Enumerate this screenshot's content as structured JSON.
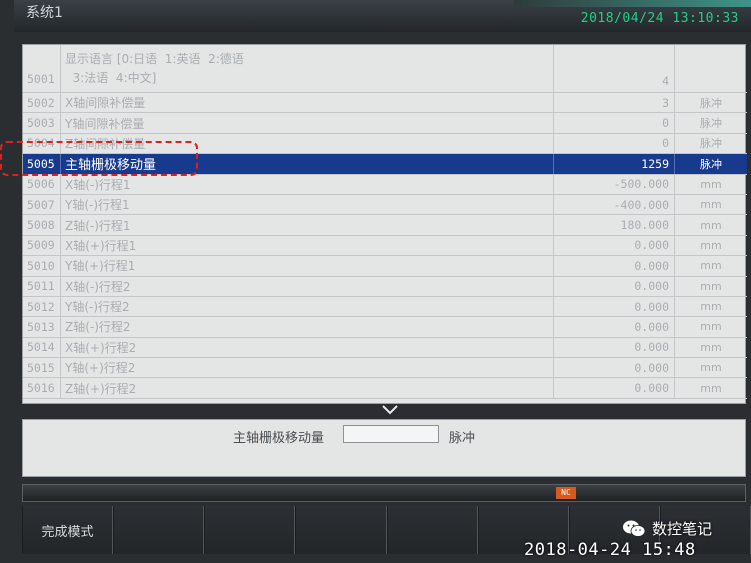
{
  "window": {
    "title": "系统1",
    "datetime": "2018/04/24 13:10:33",
    "accent_color": "#3f9a8e"
  },
  "params": [
    {
      "num": "5001",
      "name_lines": [
        "显示语言 [0:日语  1:英语  2:德语",
        "  3:法语  4:中文]"
      ],
      "value": "4",
      "unit": ""
    },
    {
      "num": "5002",
      "name": "X轴间隙补偿量",
      "value": "3",
      "unit": "脉冲"
    },
    {
      "num": "5003",
      "name": "Y轴间隙补偿量",
      "value": "0",
      "unit": "脉冲"
    },
    {
      "num": "5004",
      "name": "Z轴间隙补偿量",
      "value": "0",
      "unit": "脉冲"
    },
    {
      "num": "5005",
      "name": "主轴栅极移动量",
      "value": "1259",
      "unit": "脉冲",
      "selected": true
    },
    {
      "num": "5006",
      "name": "X轴(-)行程1",
      "value": "-500.000",
      "unit": "mm"
    },
    {
      "num": "5007",
      "name": "Y轴(-)行程1",
      "value": "-400.000",
      "unit": "mm"
    },
    {
      "num": "5008",
      "name": "Z轴(-)行程1",
      "value": "180.000",
      "unit": "mm"
    },
    {
      "num": "5009",
      "name": "X轴(+)行程1",
      "value": "0.000",
      "unit": "mm"
    },
    {
      "num": "5010",
      "name": "Y轴(+)行程1",
      "value": "0.000",
      "unit": "mm"
    },
    {
      "num": "5011",
      "name": "X轴(-)行程2",
      "value": "0.000",
      "unit": "mm"
    },
    {
      "num": "5012",
      "name": "Y轴(-)行程2",
      "value": "0.000",
      "unit": "mm"
    },
    {
      "num": "5013",
      "name": "Z轴(-)行程2",
      "value": "0.000",
      "unit": "mm"
    },
    {
      "num": "5014",
      "name": "X轴(+)行程2",
      "value": "0.000",
      "unit": "mm"
    },
    {
      "num": "5015",
      "name": "Y轴(+)行程2",
      "value": "0.000",
      "unit": "mm"
    },
    {
      "num": "5016",
      "name": "Z轴(+)行程2",
      "value": "0.000",
      "unit": "mm"
    }
  ],
  "selection_color": "#173a8c",
  "highlight_color": "#e02020",
  "input": {
    "label": "主轴栅极移动量",
    "value": "",
    "unit": "脉冲"
  },
  "status": {
    "icon_text": "NC",
    "icon_color": "#d9591a"
  },
  "softkeys": [
    "完成模式",
    "",
    "",
    "",
    "",
    "",
    "",
    ""
  ],
  "watermark": {
    "icon": "wechat-icon",
    "text": "数控笔记"
  },
  "photo_timestamp": "2018-04-24  15:48"
}
